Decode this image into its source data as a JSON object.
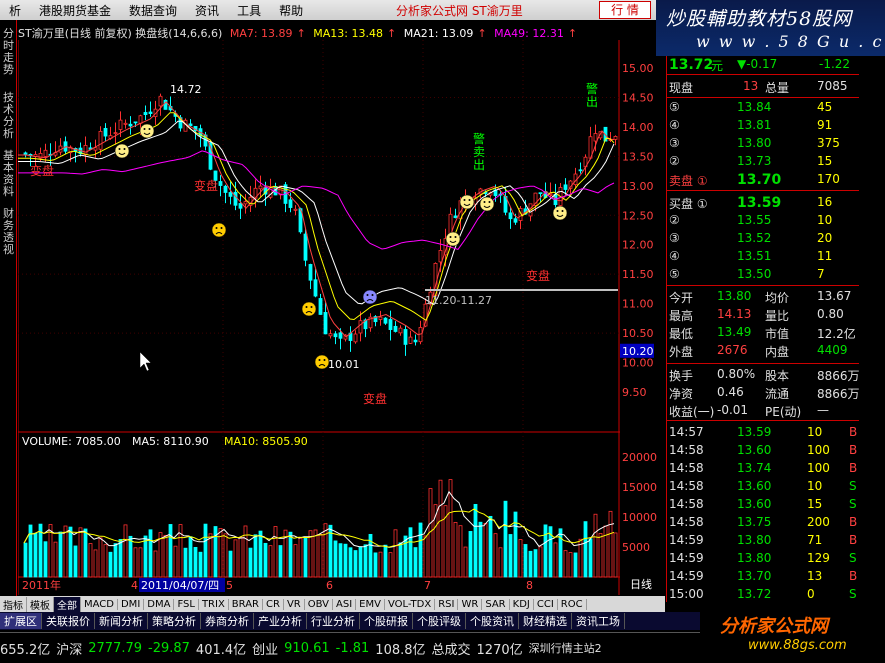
{
  "menu": {
    "items": [
      "析",
      "港股期货基金",
      "数据查询",
      "资讯",
      "工具",
      "帮助"
    ],
    "site_link": "分析家公式网 ST渝万里",
    "trade_button": "行 情"
  },
  "banner": {
    "line1": "炒股輔助教材58股网",
    "line2": "w w w . 5 8 G u . c o m"
  },
  "left_tabs": [
    "分时走势",
    "技术分析",
    "基本资料",
    "财务透视"
  ],
  "chart": {
    "title": "ST渝万里(日线 前复权) 换盘线(14,6,6,6)",
    "ma": [
      {
        "label": "MA7: 13.89",
        "color": "#ff4040"
      },
      {
        "label": "MA13: 13.48",
        "color": "#ffff00"
      },
      {
        "label": "MA21: 13.09",
        "color": "#ffffff"
      },
      {
        "label": "MA49: 12.31",
        "color": "#ff00ff"
      }
    ],
    "price_axis": [
      "15.00",
      "14.50",
      "14.00",
      "13.50",
      "13.00",
      "12.50",
      "12.00",
      "11.50",
      "11.00",
      "10.50",
      "10.00",
      "9.50"
    ],
    "current_price_tag": "10.20",
    "annotations": {
      "high_label": "14.72",
      "low_label": "10.01",
      "range_label": "11.20-11.27",
      "bianpan": "变盘",
      "jing_chu": "警出",
      "jing_mai_chu": "警卖出",
      "mai": "卖"
    },
    "volume_title": "VOLUME: 7085.00",
    "volume_ma5": "MA5: 8110.90",
    "volume_ma10": "MA10: 8505.90",
    "volume_axis": [
      "20000",
      "15000",
      "10000",
      "5000"
    ],
    "date_axis": [
      "2011年",
      "4",
      "2011/04/07/四",
      "5",
      "6",
      "7",
      "8"
    ],
    "period": "日线"
  },
  "chart_data": {
    "type": "candlestick",
    "title": "ST渝万里(日线 前复权)",
    "ylim": [
      9.3,
      15.2
    ],
    "price_range_labeled": {
      "high": 14.72,
      "low": 10.01
    },
    "moving_averages": {
      "MA7": 13.89,
      "MA13": 13.48,
      "MA21": 13.09,
      "MA49": 12.31
    },
    "volume": {
      "last": 7085.0,
      "MA5": 8110.9,
      "MA10": 8505.9,
      "ylim": [
        0,
        22000
      ]
    }
  },
  "quote": {
    "price": "13.72",
    "unit": "元",
    "change": "▼-0.17",
    "change_pct": "-1.22",
    "xianpan_label": "现盘",
    "xianpan": "13",
    "zongliang_label": "总量",
    "zongliang": "7085",
    "sells": [
      {
        "n": "⑤",
        "price": "13.84",
        "vol": "45"
      },
      {
        "n": "④",
        "price": "13.81",
        "vol": "91"
      },
      {
        "n": "③",
        "price": "13.80",
        "vol": "375"
      },
      {
        "n": "②",
        "price": "13.73",
        "vol": "15"
      },
      {
        "n": "卖盘 ①",
        "price": "13.70",
        "vol": "170"
      }
    ],
    "buys": [
      {
        "n": "买盘 ①",
        "price": "13.59",
        "vol": "16"
      },
      {
        "n": "②",
        "price": "13.55",
        "vol": "10"
      },
      {
        "n": "③",
        "price": "13.52",
        "vol": "20"
      },
      {
        "n": "④",
        "price": "13.51",
        "vol": "11"
      },
      {
        "n": "⑤",
        "price": "13.50",
        "vol": "7"
      }
    ],
    "stats": [
      {
        "k1": "今开",
        "v1": "13.80",
        "k2": "均价",
        "v2": "13.67"
      },
      {
        "k1": "最高",
        "v1": "14.13",
        "k2": "量比",
        "v2": "0.80"
      },
      {
        "k1": "最低",
        "v1": "13.49",
        "k2": "市值",
        "v2": "12.2亿"
      },
      {
        "k1": "外盘",
        "v1": "2676",
        "k2": "内盘",
        "v2": "4409"
      }
    ],
    "stats2": [
      {
        "k1": "换手",
        "v1": "0.80%",
        "k2": "股本",
        "v2": "8866万"
      },
      {
        "k1": "净资",
        "v1": "0.46",
        "k2": "流通",
        "v2": "8866万"
      },
      {
        "k1": "收益(一)",
        "v1": "-0.01",
        "k2": "PE(动)",
        "v2": "—"
      }
    ],
    "ticks": [
      {
        "t": "14:57",
        "p": "13.59",
        "v": "10",
        "d": "B"
      },
      {
        "t": "14:58",
        "p": "13.60",
        "v": "100",
        "d": "B"
      },
      {
        "t": "14:58",
        "p": "13.74",
        "v": "100",
        "d": "B"
      },
      {
        "t": "14:58",
        "p": "13.60",
        "v": "10",
        "d": "S"
      },
      {
        "t": "14:58",
        "p": "13.60",
        "v": "15",
        "d": "S"
      },
      {
        "t": "14:58",
        "p": "13.75",
        "v": "200",
        "d": "B"
      },
      {
        "t": "14:59",
        "p": "13.80",
        "v": "71",
        "d": "B"
      },
      {
        "t": "14:59",
        "p": "13.80",
        "v": "129",
        "d": "S"
      },
      {
        "t": "14:59",
        "p": "13.70",
        "v": "13",
        "d": "B"
      },
      {
        "t": "15:00",
        "p": "13.72",
        "v": "0",
        "d": "S"
      }
    ]
  },
  "indicator_tabs": [
    "指标",
    "模板",
    "全部",
    "MACD",
    "DMI",
    "DMA",
    "FSL",
    "TRIX",
    "BRAR",
    "CR",
    "VR",
    "OBV",
    "ASI",
    "EMV",
    "VOL-TDX",
    "RSI",
    "WR",
    "SAR",
    "KDJ",
    "CCI",
    "ROC"
  ],
  "function_tabs": [
    "扩展区",
    "关联报价",
    "新闻分析",
    "策略分析",
    "券商分析",
    "产业分析",
    "行业分析",
    "个股研报",
    "个股评级",
    "个股资讯",
    "财经精选",
    "资讯工场"
  ],
  "status": {
    "s1": "655.2亿",
    "sz_label": "沪深",
    "sz_val": "2777.79",
    "sz_chg": "-29.87",
    "sz_amt": "401.4亿",
    "cy_label": "创业",
    "cy_val": "910.61",
    "cy_chg": "-1.81",
    "cy_amt": "108.8亿",
    "total_label": "总成交",
    "total_val": "1270亿",
    "station": "深圳行情主站2"
  },
  "logo": {
    "l1": "分析家公式网",
    "l2": "www.88gs.com"
  }
}
